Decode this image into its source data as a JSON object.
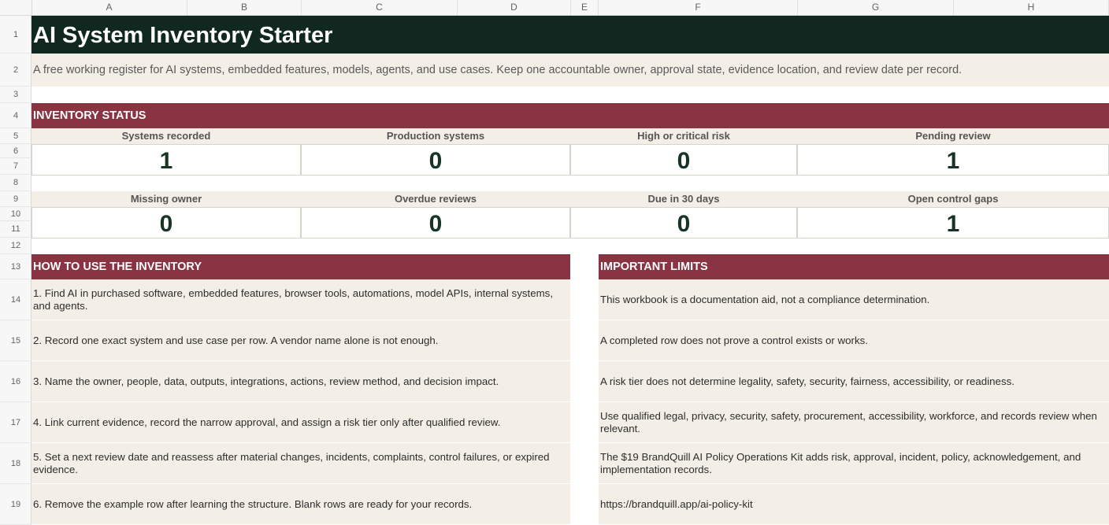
{
  "columns": [
    "A",
    "B",
    "C",
    "D",
    "E",
    "F",
    "G",
    "H"
  ],
  "rows": [
    "1",
    "2",
    "3",
    "4",
    "5",
    "6",
    "7",
    "8",
    "9",
    "10",
    "11",
    "12",
    "13",
    "14",
    "15",
    "16",
    "17",
    "18",
    "19"
  ],
  "title": "AI System Inventory Starter",
  "subtitle": "A free working register for AI systems, embedded features, models, agents, and use cases. Keep one accountable owner, approval state, evidence location, and review date per record.",
  "status": {
    "heading": "INVENTORY STATUS",
    "metrics_row1": [
      {
        "label": "Systems recorded",
        "value": "1"
      },
      {
        "label": "Production systems",
        "value": "0"
      },
      {
        "label": "High or critical risk",
        "value": "0"
      },
      {
        "label": "Pending review",
        "value": "1"
      }
    ],
    "metrics_row2": [
      {
        "label": "Missing owner",
        "value": "0"
      },
      {
        "label": "Overdue reviews",
        "value": "0"
      },
      {
        "label": "Due in 30 days",
        "value": "0"
      },
      {
        "label": "Open control gaps",
        "value": "1"
      }
    ]
  },
  "howto": {
    "heading": "HOW TO USE THE INVENTORY",
    "items": [
      "1. Find AI in purchased software, embedded features, browser tools, automations, model APIs, internal systems, and agents.",
      "2. Record one exact system and use case per row. A vendor name alone is not enough.",
      "3. Name the owner, people, data, outputs, integrations, actions, review method, and decision impact.",
      "4. Link current evidence, record the narrow approval, and assign a risk tier only after qualified review.",
      "5. Set a next review date and reassess after material changes, incidents, complaints, control failures, or expired evidence.",
      "6. Remove the example row after learning the structure. Blank rows are ready for your records."
    ]
  },
  "limits": {
    "heading": "IMPORTANT LIMITS",
    "items": [
      "This workbook is a documentation aid, not a compliance determination.",
      "A completed row does not prove a control exists or works.",
      "A risk tier does not determine legality, safety, security, fairness, accessibility, or readiness.",
      "Use qualified legal, privacy, security, safety, procurement, accessibility, workforce, and records review when relevant.",
      "The $19 BrandQuill AI Policy Operations Kit adds risk, approval, incident, policy, acknowledgement, and implementation records.",
      "https://brandquill.app/ai-policy-kit"
    ]
  },
  "colors": {
    "title_bg": "#10281f",
    "section_bg": "#8a3343",
    "band_bg": "#f3efe6",
    "value_text": "#173424"
  }
}
